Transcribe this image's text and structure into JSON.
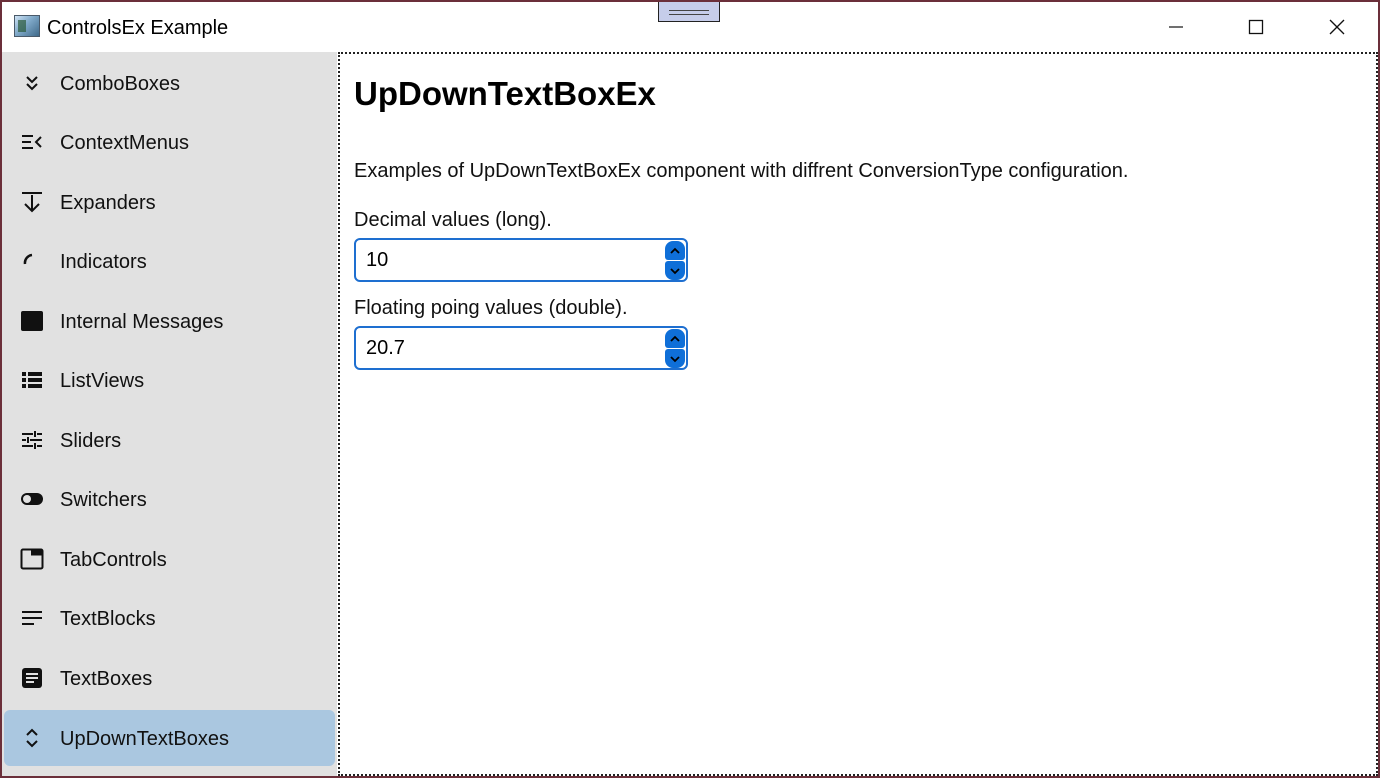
{
  "window": {
    "title": "ControlsEx Example",
    "controls": [
      "minimize-icon",
      "maximize-icon",
      "close-icon"
    ]
  },
  "sidebar": {
    "items": [
      {
        "label": "ComboBoxes",
        "icon": "double-chevron-down-icon"
      },
      {
        "label": "ContextMenus",
        "icon": "context-menu-icon"
      },
      {
        "label": "Expanders",
        "icon": "expand-down-icon"
      },
      {
        "label": "Indicators",
        "icon": "progress-arc-icon"
      },
      {
        "label": "Internal Messages",
        "icon": "message-window-icon"
      },
      {
        "label": "ListViews",
        "icon": "list-icon"
      },
      {
        "label": "Sliders",
        "icon": "sliders-icon"
      },
      {
        "label": "Switchers",
        "icon": "toggle-icon"
      },
      {
        "label": "TabControls",
        "icon": "tab-icon"
      },
      {
        "label": "TextBlocks",
        "icon": "text-lines-icon"
      },
      {
        "label": "TextBoxes",
        "icon": "text-box-icon"
      },
      {
        "label": "UpDownTextBoxes",
        "icon": "up-down-chevron-icon"
      }
    ],
    "selected": "UpDownTextBoxes"
  },
  "main": {
    "title": "UpDownTextBoxEx",
    "description": "Examples of UpDownTextBoxEx component with diffrent ConversionType configuration.",
    "fields": [
      {
        "label": "Decimal values (long).",
        "value": "10"
      },
      {
        "label": "Floating poing values (double).",
        "value": "20.7"
      }
    ]
  },
  "colors": {
    "accent": "#0f6fd8",
    "sidebar_bg": "#e1e1e1",
    "selected_bg": "#aac7e0"
  }
}
